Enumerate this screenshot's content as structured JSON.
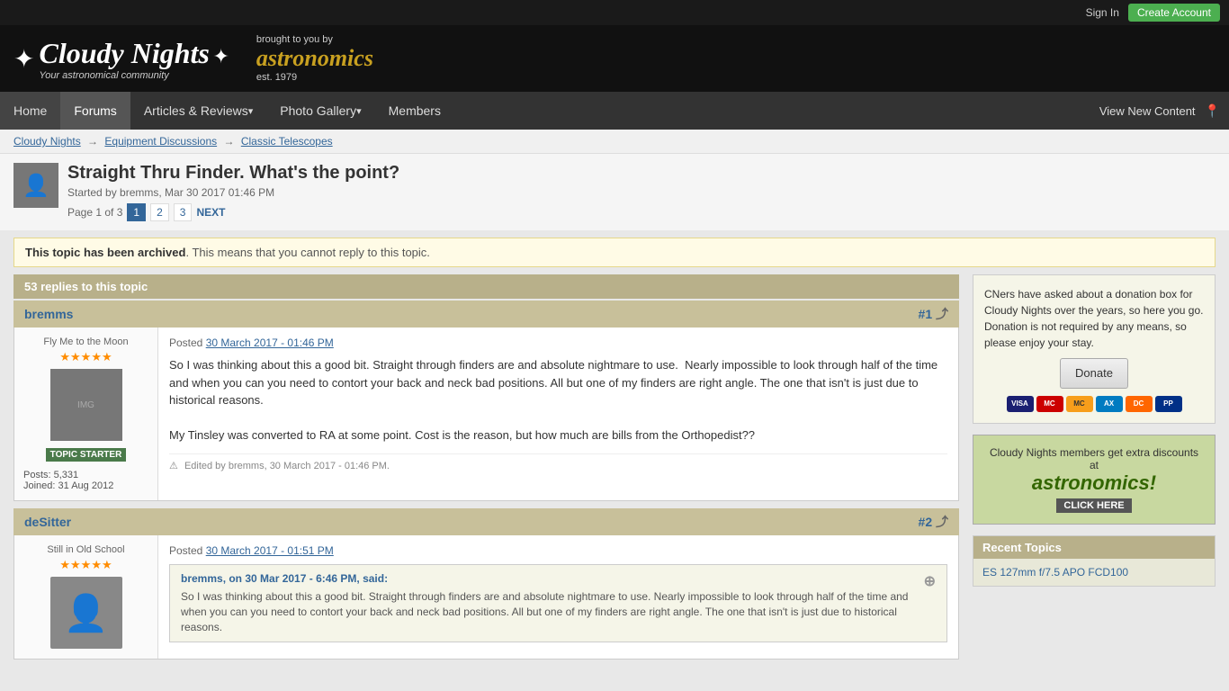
{
  "topbar": {
    "signin_label": "Sign In",
    "create_account_label": "Create Account"
  },
  "header": {
    "site_name": "Cloudy Nights",
    "tagline": "Your astronomical community",
    "sponsor_prefix": "brought to you by",
    "sponsor_name": "astronomics",
    "sponsor_est": "est. 1979"
  },
  "nav": {
    "items": [
      {
        "label": "Home",
        "active": false
      },
      {
        "label": "Forums",
        "active": true
      },
      {
        "label": "Articles & Reviews",
        "active": false,
        "dropdown": true
      },
      {
        "label": "Photo Gallery",
        "active": false,
        "dropdown": true
      },
      {
        "label": "Members",
        "active": false
      }
    ],
    "view_new_content": "View New Content",
    "location_icon": "📍"
  },
  "breadcrumb": {
    "items": [
      {
        "label": "Cloudy Nights",
        "href": "#"
      },
      {
        "label": "Equipment Discussions",
        "href": "#"
      },
      {
        "label": "Classic Telescopes",
        "href": "#"
      }
    ]
  },
  "topic": {
    "title": "Straight Thru Finder. What's the point?",
    "started_by": "Started by bremms",
    "date": "Mar 30 2017 01:46 PM",
    "pagination": {
      "label": "Page 1 of 3",
      "pages": [
        "1",
        "2",
        "3"
      ],
      "current": "1",
      "next_label": "NEXT"
    }
  },
  "archive_notice": {
    "bold": "This topic has been archived",
    "text": ". This means that you cannot reply to this topic."
  },
  "replies_bar": {
    "text": "53 replies to this topic"
  },
  "posts": [
    {
      "id": "1",
      "author": "bremms",
      "post_number": "#1",
      "rank": "Fly Me to the Moon",
      "stars": 5,
      "is_topic_starter": true,
      "posts_count": "Posts: 5,331",
      "joined": "Joined: 31 Aug 2012",
      "date": "Posted",
      "date_link": "30 March 2017 - 01:46 PM",
      "text": "So I was thinking about this a good bit. Straight through finders are and absolute nightmare to use.  Nearly impossible to look through half of the time and when you can you need to contort your back and neck bad positions. All but one of my finders are right angle. The one that isn't is just due to historical reasons.\nMy Tinsley was converted to RA at some point. Cost is the reason, but how much are bills from the Orthopedist??",
      "edit_note": "Edited by bremms, 30 March 2017 - 01:46 PM."
    },
    {
      "id": "2",
      "author": "deSitter",
      "post_number": "#2",
      "rank": "Still in Old School",
      "stars": 5,
      "is_topic_starter": false,
      "posts_count": "",
      "joined": "",
      "date": "Posted",
      "date_link": "30 March 2017 - 01:51 PM",
      "quote_author": "bremms, on 30 Mar 2017 - 6:46 PM, said:",
      "quote_text": "So I was thinking about this a good bit. Straight through finders are and absolute nightmare to use.  Nearly impossible to look through half of the time and when you can you need to contort your back and neck bad positions. All but one of my finders are right angle. The one that isn't is just due to historical reasons.",
      "text": ""
    }
  ],
  "sidebar": {
    "donation_text1": "CNers have asked about a donation box for Cloudy Nights over the years, so here you go. Donation is not required by any means, so please enjoy your stay.",
    "donate_button": "Donate",
    "astronomics_text1": "Cloudy Nights members get extra discounts at",
    "astronomics_name": "astronomics!",
    "astronomics_click": "CLICK HERE",
    "recent_topics_title": "Recent Topics",
    "recent_topic1": "ES 127mm f/7.5 APO FCD100"
  }
}
